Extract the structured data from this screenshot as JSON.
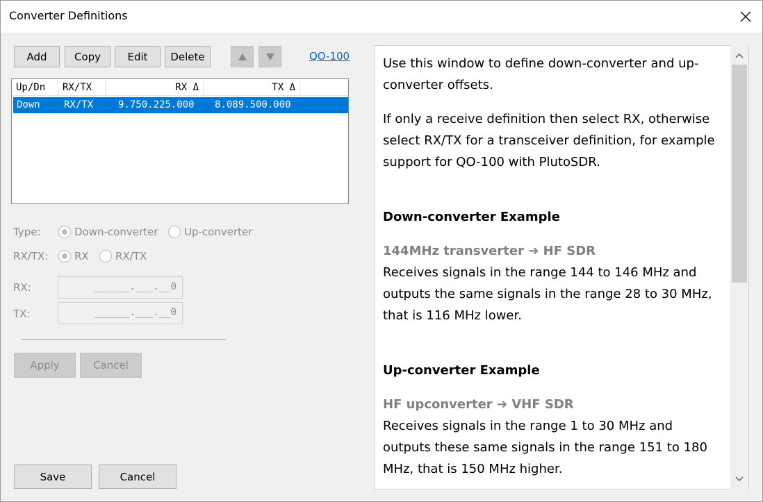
{
  "window": {
    "title": "Converter Definitions"
  },
  "toolbar": {
    "add": "Add",
    "copy": "Copy",
    "edit": "Edit",
    "delete": "Delete",
    "up_icon": "triangle-up-icon",
    "down_icon": "triangle-down-icon",
    "link": "QO-100"
  },
  "list": {
    "columns": [
      "Up/Dn",
      "RX/TX",
      "RX Δ",
      "TX Δ"
    ],
    "rows": [
      {
        "updn": "Down",
        "rxtx": "RX/TX",
        "rx": "9.750.225.000",
        "tx": "8.089.500.000",
        "selected": true
      }
    ]
  },
  "form": {
    "type_label": "Type:",
    "type_options": [
      "Down-converter",
      "Up-converter"
    ],
    "type_selected": "Down-converter",
    "rxtx_label": "RX/TX:",
    "rxtx_options": [
      "RX",
      "RX/TX"
    ],
    "rxtx_selected": "RX",
    "rx_label": "RX:",
    "rx_value": "______.___.__0",
    "tx_label": "TX:",
    "tx_value": "______.___.__0",
    "apply": "Apply",
    "cancel": "Cancel"
  },
  "footer": {
    "save": "Save",
    "cancel": "Cancel"
  },
  "help": {
    "intro": "Use this window to define down-converter and up-converter offsets.",
    "para2": "If only a receive definition then select RX, otherwise select RX/TX for a transceiver definition, for example support for QO-100 with PlutoSDR.",
    "down_heading": "Down-converter Example",
    "down_sub_a": "144MHz transverter",
    "down_sub_b": "HF SDR",
    "down_text": "Receives signals in the range 144 to 146 MHz and outputs the same signals in the range 28 to 30 MHz, that is 116 MHz lower.",
    "up_heading": "Up-converter Example",
    "up_sub_a": "HF upconverter",
    "up_sub_b": "VHF SDR",
    "up_text": "Receives signals in the range 1 to 30 MHz and outputs these same signals in the range 151 to 180 MHz, that is 150 MHz higher."
  },
  "colors": {
    "selection": "#0078d7",
    "link": "#0066cc",
    "disabled_text": "#8a8a8a"
  }
}
